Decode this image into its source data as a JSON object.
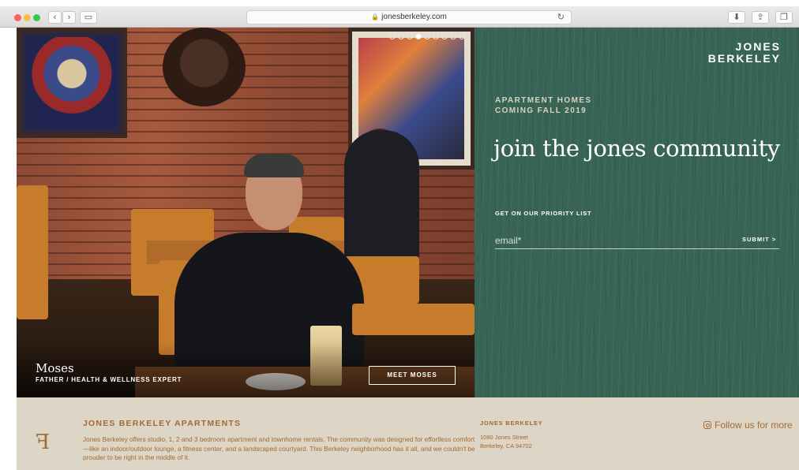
{
  "browser": {
    "url": "jonesberkeley.com",
    "back_icon": "chevron-left-icon",
    "forward_icon": "chevron-right-icon"
  },
  "hero": {
    "carousel": {
      "total_slides": 9,
      "active_slide": 4
    },
    "person_name": "Moses",
    "person_role": "FATHER / HEALTH & WELLNESS EXPERT",
    "meet_button": "MEET MOSES"
  },
  "panel": {
    "logo_line1": "JONES",
    "logo_line2": "BERKELEY",
    "eyebrow_line1": "APARTMENT HOMES",
    "eyebrow_line2": "COMING FALL 2019",
    "headline": "join the jones community",
    "form_label": "GET ON OUR PRIORITY LIST",
    "email_placeholder": "email*",
    "submit_label": "SUBMIT >"
  },
  "footer": {
    "logo_glyph": "ꟻ",
    "title": "JONES BERKELEY APARTMENTS",
    "description": "Jones Berkeley offers studio, 1, 2 and 3 bedroom apartment and townhome rentals. The community was designed for effortless comfort—like an indoor/outdoor lounge, a fitness center, and a landscaped courtyard. This Berkeley neighborhood has it all, and we couldn't be prouder to be right in the middle of it.",
    "contact_title": "JONES BERKELEY",
    "address_line1": "1080 Jones Street",
    "address_line2": "Berkeley, CA 94702",
    "follow_text": "Follow us for more"
  },
  "colors": {
    "panel_green": "#386456",
    "footer_bg": "#ddd5c6",
    "footer_accent": "#a36a33"
  }
}
